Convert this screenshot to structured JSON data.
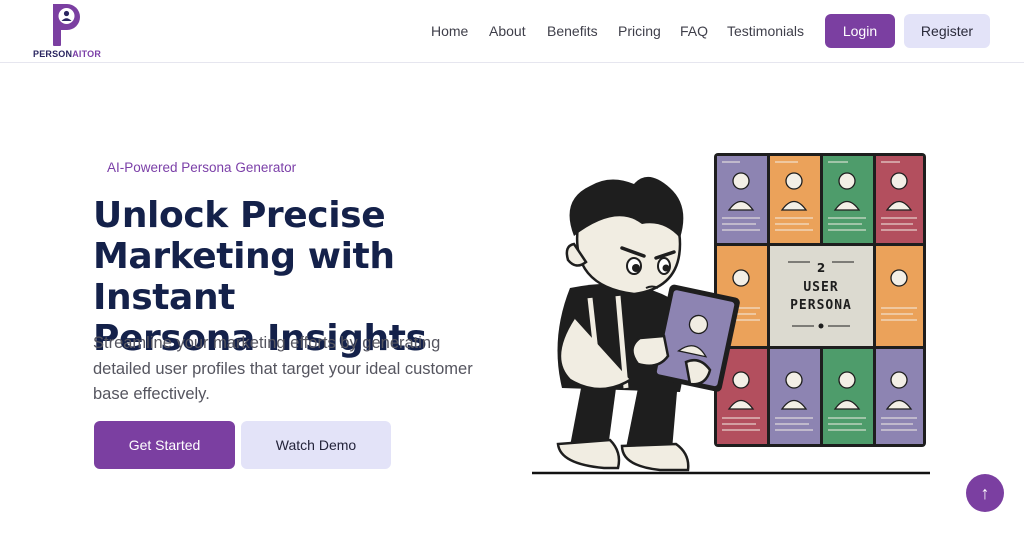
{
  "brand": {
    "logo_letter": "P",
    "name_part1": "PERSON",
    "name_part2": "AITOR",
    "accent": "#7b3fa1",
    "navy": "#14214a"
  },
  "nav": {
    "items": [
      "Home",
      "About",
      "Benefits",
      "Pricing",
      "FAQ",
      "Testimonials"
    ],
    "login_label": "Login",
    "register_label": "Register"
  },
  "hero": {
    "eyebrow": "AI-Powered Persona Generator",
    "headline_line1": "Unlock Precise",
    "headline_line2": "Marketing with Instant",
    "headline_line3": "Persona Insights",
    "subtext": "Streamline your marketing efforts by generating detailed user profiles that target your ideal customer base effectively.",
    "primary_cta": "Get Started",
    "secondary_cta": "Watch Demo"
  },
  "illustration": {
    "board_number": "2",
    "board_line1": "USER",
    "board_line2": "PERSONA",
    "icon": "persona-board-illustration"
  },
  "scroll_top": {
    "icon": "arrow-up-icon",
    "glyph": "↑"
  }
}
